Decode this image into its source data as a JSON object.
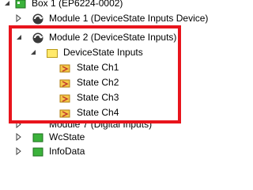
{
  "tree": {
    "items": [
      {
        "label": "Box 1 (EP6224-0002)",
        "icon": "box-icon"
      },
      {
        "label": "Module 1 (DeviceState Inputs Device)",
        "icon": "module-icon"
      },
      {
        "label": "Module 2 (DeviceState Inputs)",
        "icon": "module-icon"
      },
      {
        "label": "DeviceState Inputs",
        "icon": "folder-icon"
      },
      {
        "label": "State Ch1",
        "icon": "input-variable-icon"
      },
      {
        "label": "State Ch2",
        "icon": "input-variable-icon"
      },
      {
        "label": "State Ch3",
        "icon": "input-variable-icon"
      },
      {
        "label": "State Ch4",
        "icon": "input-variable-icon"
      },
      {
        "label": "Module 7 (Digital Inputs)",
        "icon": "module-icon"
      },
      {
        "label": "WcState",
        "icon": "green-block-icon"
      },
      {
        "label": "InfoData",
        "icon": "green-block-icon"
      }
    ]
  },
  "colors": {
    "highlight_border": "#e8141c",
    "folder_fill": "#ffe96b",
    "green_block": "#3bb23b",
    "arrow": "#404040"
  }
}
